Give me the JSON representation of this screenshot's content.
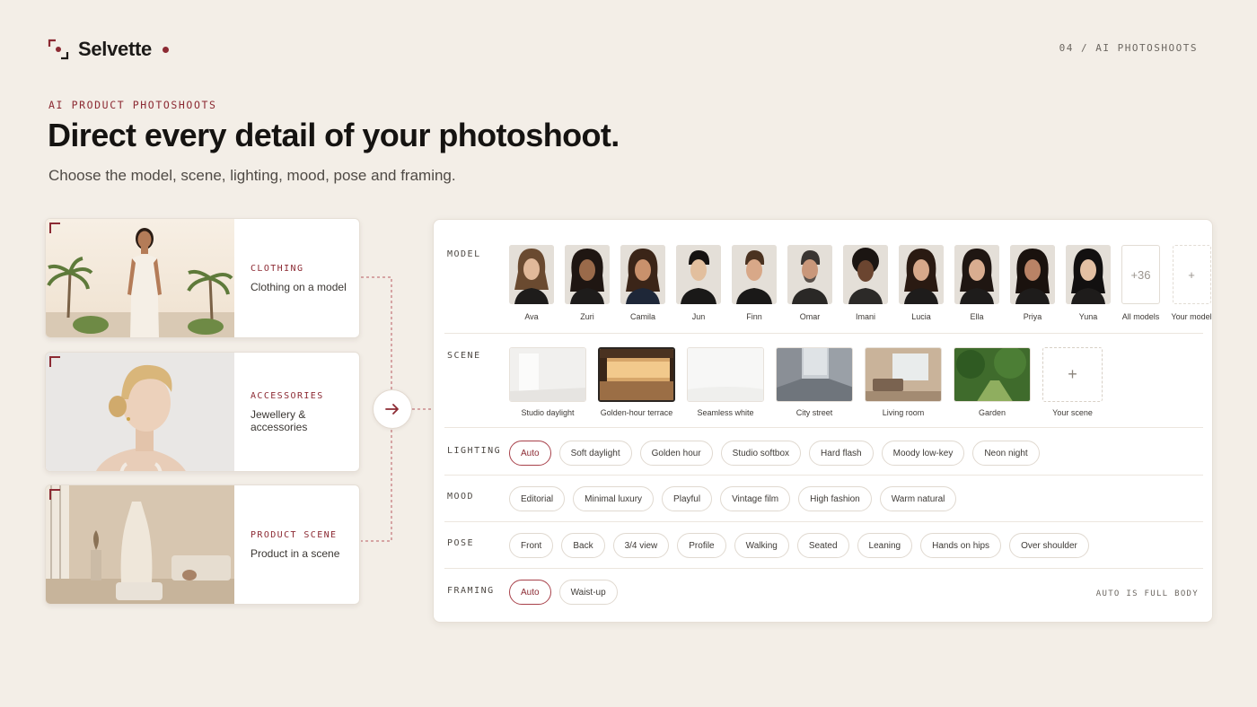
{
  "brand": {
    "name": "Selvette"
  },
  "header": {
    "page_indicator": "04 / AI PHOTOSHOOTS"
  },
  "hero": {
    "eyebrow": "AI PRODUCT PHOTOSHOOTS",
    "title": "Direct every detail of your photoshoot.",
    "subtitle": "Choose the model, scene, lighting, mood, pose and framing."
  },
  "categories": [
    {
      "label": "CLOTHING",
      "desc": "Clothing on a model"
    },
    {
      "label": "ACCESSORIES",
      "desc": "Jewellery & accessories"
    },
    {
      "label": "PRODUCT SCENE",
      "desc": "Product in a scene"
    }
  ],
  "panel": {
    "model": {
      "label": "MODEL",
      "items": [
        "Ava",
        "Zuri",
        "Camila",
        "Jun",
        "Finn",
        "Omar",
        "Imani",
        "Lucia",
        "Ella",
        "Priya",
        "Yuna"
      ],
      "all_models_count": "+36",
      "all_models_label": "All models",
      "your_model_symbol": "+",
      "your_model_label": "Your model"
    },
    "scene": {
      "label": "SCENE",
      "items": [
        "Studio daylight",
        "Golden-hour terrace",
        "Seamless white",
        "City street",
        "Living room",
        "Garden"
      ],
      "selected": "Golden-hour terrace",
      "add_symbol": "+",
      "add_label": "Your scene"
    },
    "lighting": {
      "label": "LIGHTING",
      "options": [
        "Auto",
        "Soft daylight",
        "Golden hour",
        "Studio softbox",
        "Hard flash",
        "Moody low-key",
        "Neon night"
      ],
      "selected": "Auto"
    },
    "mood": {
      "label": "MOOD",
      "options": [
        "Editorial",
        "Minimal luxury",
        "Playful",
        "Vintage film",
        "High fashion",
        "Warm natural"
      ]
    },
    "pose": {
      "label": "POSE",
      "options": [
        "Front",
        "Back",
        "3/4 view",
        "Profile",
        "Walking",
        "Seated",
        "Leaning",
        "Hands on hips",
        "Over shoulder"
      ]
    },
    "framing": {
      "label": "FRAMING",
      "options": [
        "Auto",
        "Waist-up"
      ],
      "selected": "Auto",
      "note": "AUTO IS FULL BODY"
    }
  },
  "colors": {
    "accent": "#8c2a33",
    "background": "#f3eee7",
    "card": "#ffffff"
  },
  "icons": {
    "next": "arrow-right-icon",
    "brand": "viewfinder-icon"
  }
}
